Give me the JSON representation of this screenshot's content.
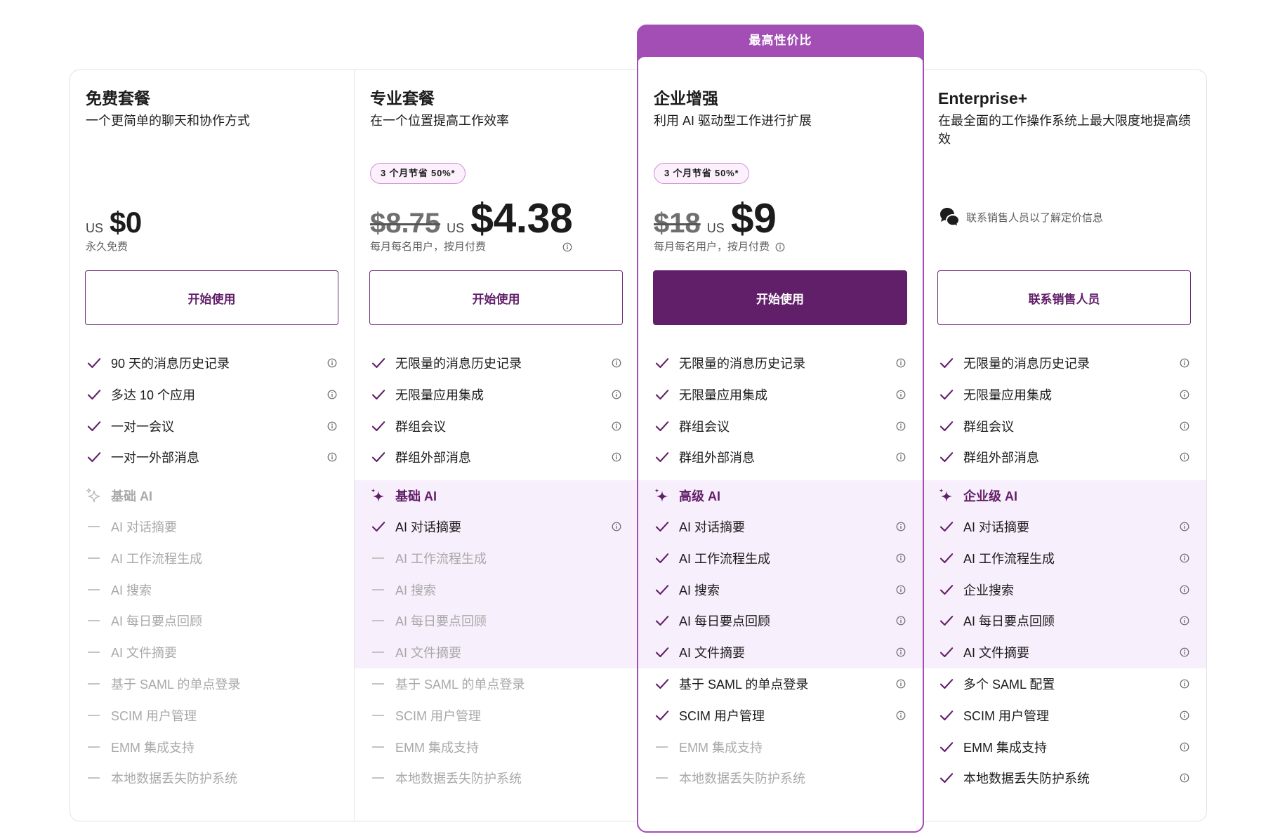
{
  "highlight_banner": "最高性价比",
  "plans": [
    {
      "name": "免费套餐",
      "description": "一个更简单的聊天和协作方式",
      "currency": "US",
      "price": "$0",
      "price_note": "永久免费",
      "price_info": false,
      "cta": "开始使用",
      "cta_primary": false,
      "featured": false,
      "core_features": [
        {
          "label": "90 天的消息历史记录",
          "included": true,
          "info": true
        },
        {
          "label": "多达 10 个应用",
          "included": true,
          "info": true
        },
        {
          "label": "一对一会议",
          "included": true,
          "info": true
        },
        {
          "label": "一对一外部消息",
          "included": true,
          "info": true
        }
      ],
      "ai_tier": {
        "label": "基础 AI",
        "enabled": false
      },
      "ai_features": [
        {
          "label": "AI 对话摘要",
          "included": false,
          "info": false
        },
        {
          "label": "AI 工作流程生成",
          "included": false,
          "info": false
        },
        {
          "label": "AI 搜索",
          "included": false,
          "info": false
        },
        {
          "label": "AI 每日要点回顾",
          "included": false,
          "info": false
        },
        {
          "label": "AI 文件摘要",
          "included": false,
          "info": false
        }
      ],
      "admin_features": [
        {
          "label": "基于 SAML 的单点登录",
          "included": false,
          "info": false
        },
        {
          "label": "SCIM 用户管理",
          "included": false,
          "info": false
        },
        {
          "label": "EMM 集成支持",
          "included": false,
          "info": false
        },
        {
          "label": "本地数据丢失防护系统",
          "included": false,
          "info": false
        }
      ]
    },
    {
      "name": "专业套餐",
      "description": "在一个位置提高工作效率",
      "badge": "3 个月节省 50%*",
      "original_price": "$8.75",
      "currency": "US",
      "price": "$4.38",
      "price_note": "每月每名用户，按月付费",
      "price_info": true,
      "cta": "开始使用",
      "cta_primary": false,
      "featured": false,
      "core_features": [
        {
          "label": "无限量的消息历史记录",
          "included": true,
          "info": true
        },
        {
          "label": "无限量应用集成",
          "included": true,
          "info": true
        },
        {
          "label": "群组会议",
          "included": true,
          "info": true
        },
        {
          "label": "群组外部消息",
          "included": true,
          "info": true
        }
      ],
      "ai_tier": {
        "label": "基础 AI",
        "enabled": true
      },
      "ai_features": [
        {
          "label": "AI 对话摘要",
          "included": true,
          "info": true
        },
        {
          "label": "AI 工作流程生成",
          "included": false,
          "info": false
        },
        {
          "label": "AI 搜索",
          "included": false,
          "info": false
        },
        {
          "label": "AI 每日要点回顾",
          "included": false,
          "info": false
        },
        {
          "label": "AI 文件摘要",
          "included": false,
          "info": false
        }
      ],
      "admin_features": [
        {
          "label": "基于 SAML 的单点登录",
          "included": false,
          "info": false
        },
        {
          "label": "SCIM 用户管理",
          "included": false,
          "info": false
        },
        {
          "label": "EMM 集成支持",
          "included": false,
          "info": false
        },
        {
          "label": "本地数据丢失防护系统",
          "included": false,
          "info": false
        }
      ]
    },
    {
      "name": "企业增强",
      "description": "利用 AI 驱动型工作进行扩展",
      "badge": "3 个月节省 50%*",
      "original_price": "$18",
      "currency": "US",
      "price": "$9",
      "price_note": "每月每名用户，按月付费",
      "price_info": true,
      "cta": "开始使用",
      "cta_primary": true,
      "featured": true,
      "core_features": [
        {
          "label": "无限量的消息历史记录",
          "included": true,
          "info": true
        },
        {
          "label": "无限量应用集成",
          "included": true,
          "info": true
        },
        {
          "label": "群组会议",
          "included": true,
          "info": true
        },
        {
          "label": "群组外部消息",
          "included": true,
          "info": true
        }
      ],
      "ai_tier": {
        "label": "高级 AI",
        "enabled": true
      },
      "ai_features": [
        {
          "label": "AI 对话摘要",
          "included": true,
          "info": true
        },
        {
          "label": "AI 工作流程生成",
          "included": true,
          "info": true
        },
        {
          "label": "AI 搜索",
          "included": true,
          "info": true
        },
        {
          "label": "AI 每日要点回顾",
          "included": true,
          "info": true
        },
        {
          "label": "AI 文件摘要",
          "included": true,
          "info": true
        }
      ],
      "admin_features": [
        {
          "label": "基于 SAML 的单点登录",
          "included": true,
          "info": true
        },
        {
          "label": "SCIM 用户管理",
          "included": true,
          "info": true
        },
        {
          "label": "EMM 集成支持",
          "included": false,
          "info": false
        },
        {
          "label": "本地数据丢失防护系统",
          "included": false,
          "info": false
        }
      ]
    },
    {
      "name": "Enterprise+",
      "description": "在最全面的工作操作系统上最大限度地提高绩效",
      "contact_note": "联系销售人员以了解定价信息",
      "cta": "联系销售人员",
      "cta_primary": false,
      "featured": false,
      "core_features": [
        {
          "label": "无限量的消息历史记录",
          "included": true,
          "info": true
        },
        {
          "label": "无限量应用集成",
          "included": true,
          "info": true
        },
        {
          "label": "群组会议",
          "included": true,
          "info": true
        },
        {
          "label": "群组外部消息",
          "included": true,
          "info": true
        }
      ],
      "ai_tier": {
        "label": "企业级 AI",
        "enabled": true
      },
      "ai_features": [
        {
          "label": "AI 对话摘要",
          "included": true,
          "info": true
        },
        {
          "label": "AI 工作流程生成",
          "included": true,
          "info": true
        },
        {
          "label": "企业搜索",
          "included": true,
          "info": true
        },
        {
          "label": "AI 每日要点回顾",
          "included": true,
          "info": true
        },
        {
          "label": "AI 文件摘要",
          "included": true,
          "info": true
        }
      ],
      "admin_features": [
        {
          "label": "多个 SAML 配置",
          "included": true,
          "info": true
        },
        {
          "label": "SCIM 用户管理",
          "included": true,
          "info": true
        },
        {
          "label": "EMM 集成支持",
          "included": true,
          "info": true
        },
        {
          "label": "本地数据丢失防护系统",
          "included": true,
          "info": true
        }
      ]
    }
  ],
  "icons": {
    "included": "check-icon",
    "excluded": "dash-icon",
    "info": "info-icon",
    "ai_tier": "sparkle-icon",
    "contact": "chat-bubbles-icon"
  },
  "colors": {
    "accent": "#611f69",
    "highlight": "#a24eb4",
    "ai_background": "#f8effc",
    "muted_text": "#a9a9a9",
    "badge_background": "#fcf0fd"
  }
}
